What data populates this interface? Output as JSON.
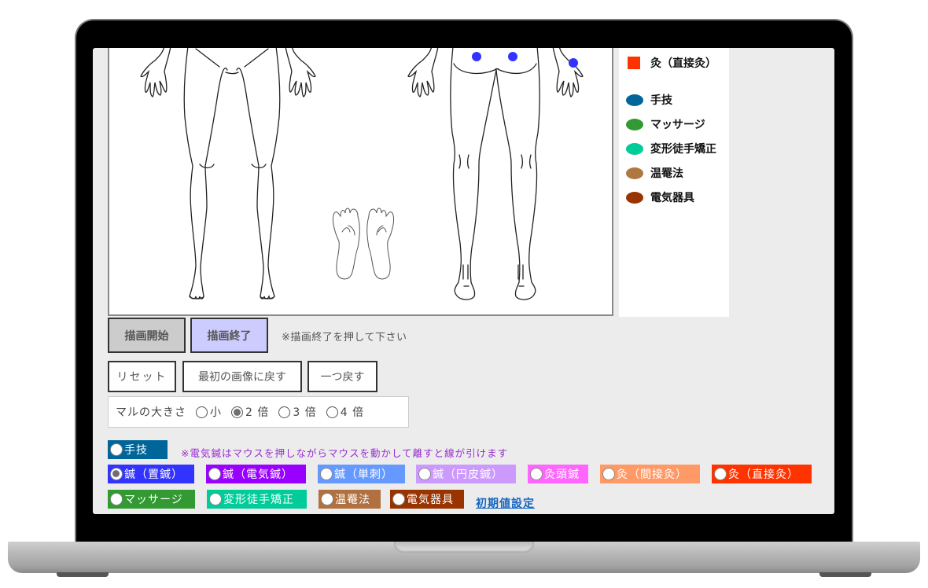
{
  "legend": {
    "items": [
      {
        "label": "灸（直接灸）",
        "color": "#ff3300",
        "shape": "square"
      },
      {
        "label": "手技",
        "color": "#006699",
        "shape": "ellipse"
      },
      {
        "label": "マッサージ",
        "color": "#339933",
        "shape": "ellipse"
      },
      {
        "label": "変形徒手矯正",
        "color": "#00cc99",
        "shape": "ellipse"
      },
      {
        "label": "温罨法",
        "color": "#b07840",
        "shape": "ellipse"
      },
      {
        "label": "電気器具",
        "color": "#993300",
        "shape": "ellipse"
      }
    ]
  },
  "drawing": {
    "start_label": "描画開始",
    "end_label": "描画終了",
    "end_note": "※描画終了を押して下さい",
    "markers_color": "#3333ff"
  },
  "actions": {
    "reset_label": "リセット",
    "restore_label": "最初の画像に戻す",
    "undo_label": "一つ戻す"
  },
  "circle_size": {
    "label": "マルの大きさ",
    "options": [
      {
        "label": "小",
        "checked": false
      },
      {
        "label": "2 倍",
        "checked": true
      },
      {
        "label": "3 倍",
        "checked": false
      },
      {
        "label": "4 倍",
        "checked": false
      }
    ]
  },
  "treatments": {
    "note": "※電気鍼はマウスを押しながらマウスを動かして離すと線が引けます",
    "items": [
      {
        "label": "手技",
        "color": "#006699",
        "checked": false
      },
      {
        "label": "鍼（置鍼）",
        "color": "#3333ff",
        "checked": true
      },
      {
        "label": "鍼（電気鍼）",
        "color": "#9900ff",
        "checked": false
      },
      {
        "label": "鍼（単刺）",
        "color": "#6699ff",
        "checked": false
      },
      {
        "label": "鍼（円皮鍼）",
        "color": "#cc99ff",
        "checked": false
      },
      {
        "label": "灸頭鍼",
        "color": "#ff66ff",
        "checked": false
      },
      {
        "label": "灸（間接灸）",
        "color": "#ff9966",
        "checked": false
      },
      {
        "label": "灸（直接灸）",
        "color": "#ff3300",
        "checked": false
      },
      {
        "label": "マッサージ",
        "color": "#339933",
        "checked": false
      },
      {
        "label": "変形徒手矯正",
        "color": "#00cc99",
        "checked": false
      },
      {
        "label": "温罨法",
        "color": "#b07040",
        "checked": false
      },
      {
        "label": "電気器具",
        "color": "#993300",
        "checked": false
      }
    ],
    "defaults_link": "初期値設定"
  }
}
